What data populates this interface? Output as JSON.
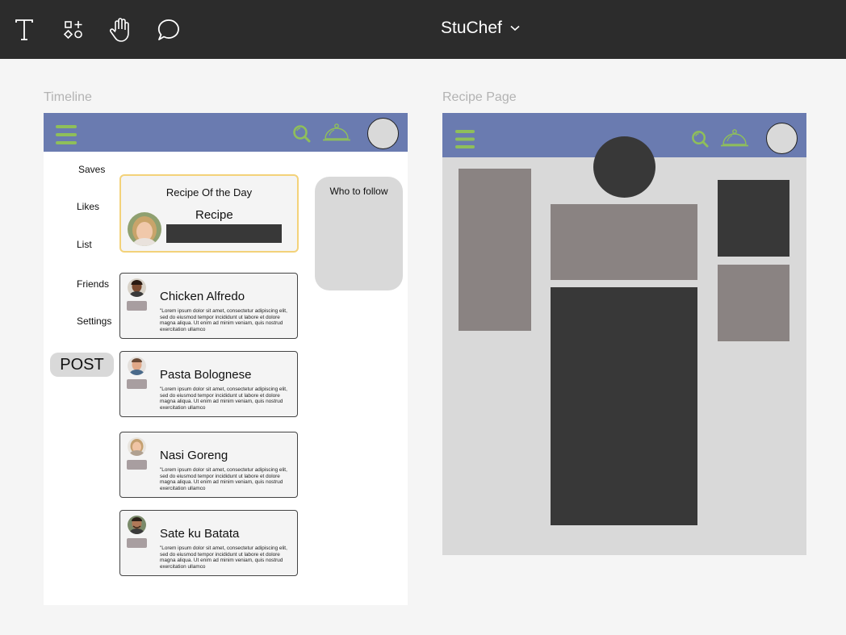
{
  "toolbar": {
    "tools": [
      {
        "icon": "text-icon"
      },
      {
        "icon": "components-icon"
      },
      {
        "icon": "hand-icon"
      },
      {
        "icon": "comment-icon"
      }
    ],
    "document_title": "StuChef"
  },
  "frames": {
    "timeline_label": "Timeline",
    "recipe_page_label": "Recipe Page"
  },
  "timeline": {
    "header_icons": [
      "hamburger-menu-icon",
      "search-icon",
      "cloche-icon",
      "profile-avatar"
    ],
    "sidebar": {
      "items": [
        {
          "label": "Saves"
        },
        {
          "label": "Likes"
        },
        {
          "label": "List"
        },
        {
          "label": "Friends"
        },
        {
          "label": "Settings"
        }
      ],
      "post_label": "POST"
    },
    "recipe_of_the_day": {
      "title": "Recipe Of the Day",
      "recipe_label": "Recipe"
    },
    "who_to_follow": {
      "title": "Who to follow"
    },
    "posts": [
      {
        "title": "Chicken Alfredo",
        "text": "\"Lorem ipsum dolor sit amet, consectetur adipiscing elit, sed do eiusmod tempor incididunt ut labore et dolore magna aliqua. Ut enim ad minim veniam, quis nostrud exercitation ullamco"
      },
      {
        "title": "Pasta Bolognese",
        "text": "\"Lorem ipsum dolor sit amet, consectetur adipiscing elit, sed do eiusmod tempor incididunt ut labore et dolore magna aliqua. Ut enim ad minim veniam, quis nostrud exercitation ullamco"
      },
      {
        "title": "Nasi Goreng",
        "text": "\"Lorem ipsum dolor sit amet, consectetur adipiscing elit, sed do eiusmod tempor incididunt ut labore et dolore magna aliqua. Ut enim ad minim veniam, quis nostrud exercitation ullamco"
      },
      {
        "title": "Sate ku Batata",
        "text": "\"Lorem ipsum dolor sit amet, consectetur adipiscing elit, sed do eiusmod tempor incididunt ut labore et dolore magna aliqua. Ut enim ad minim veniam, quis nostrud exercitation ullamco"
      }
    ]
  },
  "colors": {
    "topbar": "#2c2c2c",
    "header": "#6a7bb0",
    "accent_green": "#8fbf5a",
    "highlight_border": "#f3d27a",
    "placeholder_dark": "#383838",
    "placeholder_mid": "#8a8382",
    "canvas": "#f5f5f5"
  }
}
